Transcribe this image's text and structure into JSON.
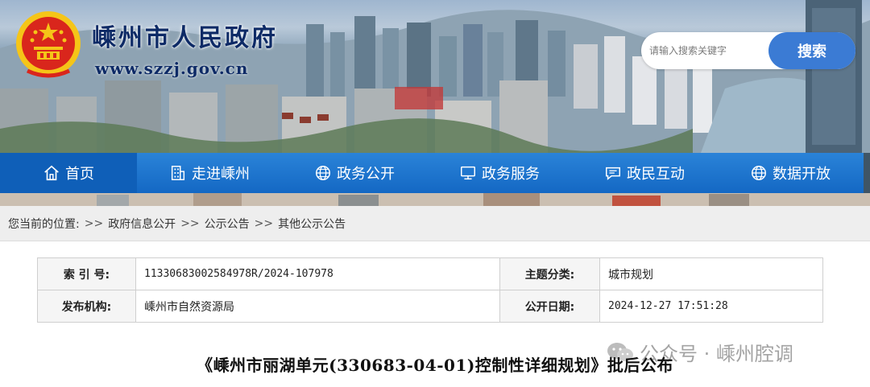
{
  "header": {
    "site_title": "嵊州市人民政府",
    "site_url": "www.szzj.gov.cn"
  },
  "search": {
    "placeholder": "请输入搜索关键字",
    "button_label": "搜索"
  },
  "nav": {
    "items": [
      {
        "label": "首页",
        "icon": "home-icon"
      },
      {
        "label": "走进嵊州",
        "icon": "building-icon"
      },
      {
        "label": "政务公开",
        "icon": "globe-icon"
      },
      {
        "label": "政务服务",
        "icon": "monitor-icon"
      },
      {
        "label": "政民互动",
        "icon": "chat-icon"
      },
      {
        "label": "数据开放",
        "icon": "globe-icon"
      }
    ]
  },
  "breadcrumb": {
    "prefix": "您当前的位置:",
    "items": [
      "政府信息公开",
      "公示公告",
      "其他公示公告"
    ]
  },
  "info": {
    "index_label": "索 引 号:",
    "index_value": "11330683002584978R/2024-107978",
    "topic_label": "主题分类:",
    "topic_value": "城市规划",
    "publisher_label": "发布机构:",
    "publisher_value": "嵊州市自然资源局",
    "date_label": "公开日期:",
    "date_value": "2024-12-27 17:51:28"
  },
  "doc": {
    "title": "《嵊州市丽湖单元(330683-04-01)控制性详细规划》批后公布"
  },
  "watermark": {
    "text": "公众号 · 嵊州腔调"
  },
  "colors": {
    "nav_blue": "#1a73cf",
    "nav_active": "#0f5fb8",
    "search_button": "#3b7bd4",
    "title_navy": "#0d2a66",
    "emblem_red": "#d9261c",
    "emblem_gold": "#f5c518"
  }
}
